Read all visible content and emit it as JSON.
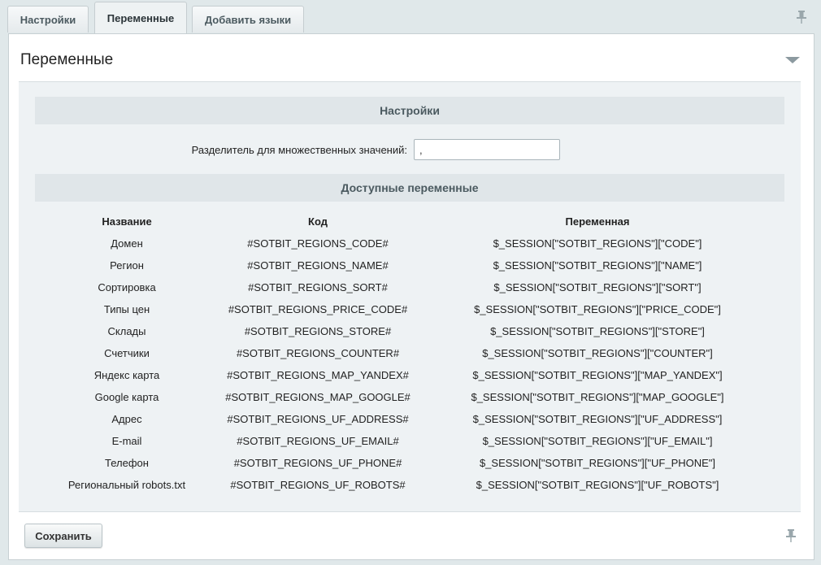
{
  "tabs": [
    {
      "label": "Настройки",
      "active": false
    },
    {
      "label": "Переменные",
      "active": true
    },
    {
      "label": "Добавить языки",
      "active": false
    }
  ],
  "panel": {
    "title": "Переменные"
  },
  "settings": {
    "header": "Настройки",
    "separator_label": "Разделитель для множественных значений:",
    "separator_value": ","
  },
  "variables": {
    "header": "Доступные переменные",
    "columns": [
      "Название",
      "Код",
      "Переменная"
    ],
    "rows": [
      [
        "Домен",
        "#SOTBIT_REGIONS_CODE#",
        "$_SESSION[\"SOTBIT_REGIONS\"][\"CODE\"]"
      ],
      [
        "Регион",
        "#SOTBIT_REGIONS_NAME#",
        "$_SESSION[\"SOTBIT_REGIONS\"][\"NAME\"]"
      ],
      [
        "Сортировка",
        "#SOTBIT_REGIONS_SORT#",
        "$_SESSION[\"SOTBIT_REGIONS\"][\"SORT\"]"
      ],
      [
        "Типы цен",
        "#SOTBIT_REGIONS_PRICE_CODE#",
        "$_SESSION[\"SOTBIT_REGIONS\"][\"PRICE_CODE\"]"
      ],
      [
        "Склады",
        "#SOTBIT_REGIONS_STORE#",
        "$_SESSION[\"SOTBIT_REGIONS\"][\"STORE\"]"
      ],
      [
        "Счетчики",
        "#SOTBIT_REGIONS_COUNTER#",
        "$_SESSION[\"SOTBIT_REGIONS\"][\"COUNTER\"]"
      ],
      [
        "Яндекс карта",
        "#SOTBIT_REGIONS_MAP_YANDEX#",
        "$_SESSION[\"SOTBIT_REGIONS\"][\"MAP_YANDEX\"]"
      ],
      [
        "Google карта",
        "#SOTBIT_REGIONS_MAP_GOOGLE#",
        "$_SESSION[\"SOTBIT_REGIONS\"][\"MAP_GOOGLE\"]"
      ],
      [
        "Адрес",
        "#SOTBIT_REGIONS_UF_ADDRESS#",
        "$_SESSION[\"SOTBIT_REGIONS\"][\"UF_ADDRESS\"]"
      ],
      [
        "E-mail",
        "#SOTBIT_REGIONS_UF_EMAIL#",
        "$_SESSION[\"SOTBIT_REGIONS\"][\"UF_EMAIL\"]"
      ],
      [
        "Телефон",
        "#SOTBIT_REGIONS_UF_PHONE#",
        "$_SESSION[\"SOTBIT_REGIONS\"][\"UF_PHONE\"]"
      ],
      [
        "Региональный robots.txt",
        "#SOTBIT_REGIONS_UF_ROBOTS#",
        "$_SESSION[\"SOTBIT_REGIONS\"][\"UF_ROBOTS\"]"
      ]
    ]
  },
  "footer": {
    "save_label": "Сохранить"
  },
  "icons": {
    "top_pin": "pin-icon",
    "bottom_pin": "pin-icon",
    "collapse": "chevron-down-icon"
  }
}
